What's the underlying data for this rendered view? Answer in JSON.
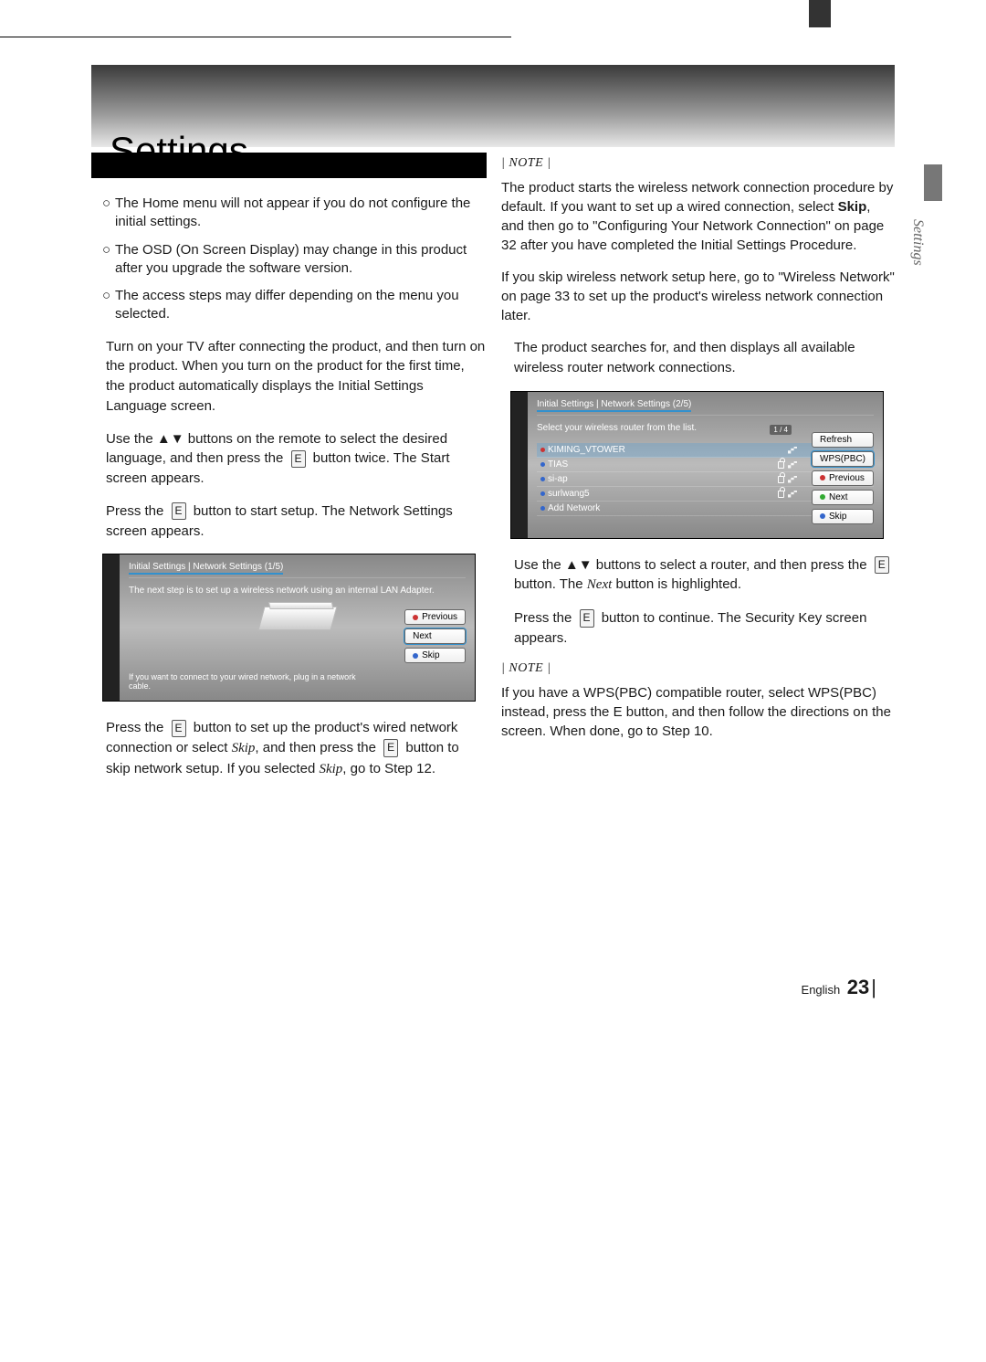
{
  "title": "Settings",
  "side_tab_label": "Settings",
  "bullets": [
    "The Home menu will not appear if you do not configure the initial settings.",
    "The OSD (On Screen Display) may change in this product after you upgrade the software version.",
    "The access steps may differ depending on the menu you selected."
  ],
  "steps_left": {
    "s1": "Turn on your TV after connecting the product, and then turn on the product. When you turn on the product for the first time, the product automatically displays the Initial Settings Language screen.",
    "s2_pre": "Use the ▲▼ buttons on the remote to select the desired language, and then press the ",
    "s2_post": " button twice. The Start screen appears.",
    "s3_pre": "Press the ",
    "s3_post": " button to start setup. The Network Settings screen appears.",
    "s4_pre": "Press the ",
    "s4_mid": " button to set up the product's wired network connection or select ",
    "s4_skip": "Skip",
    "s4_mid2": ", and then press the ",
    "s4_post": " button to skip network setup. If you selected ",
    "s4_skip2": "Skip",
    "s4_end": ", go to Step 12."
  },
  "enter_label": "E",
  "note_label": "NOTE",
  "note_right_1_pre": "The product starts the wireless network connection procedure by default. If you want to set up a wired connection, select ",
  "note_right_1_skip": "Skip",
  "note_right_1_post": ", and then go to \"Configuring Your Network Connection\" on page 32 after you have completed the Initial Settings Procedure.",
  "note_right_2": "If you skip wireless network setup here, go to \"Wireless Network\" on page 33 to set up the product's wireless network connection later.",
  "step5": "The product searches for, and then displays all available wireless router network connections.",
  "steps_right": {
    "s6_pre": "Use the ▲▼ buttons to select a router, and then press the ",
    "s6_mid": " button. The ",
    "s6_next": "Next",
    "s6_post": " button is highlighted.",
    "s7_pre": "Press the ",
    "s7_post": " button to continue. The Security Key screen appears."
  },
  "note_right_3_pre": "If you have a WPS(PBC) compatible router, select WPS(PBC) instead, press the ",
  "note_right_3_post": " button, and then follow the directions on the screen. When done, go to Step 10.",
  "tv1": {
    "crumb": "Initial Settings  |  Network Settings (1/5)",
    "desc": "The next step is to set up a wireless network using an internal LAN Adapter.",
    "foot": "If you want to connect to your wired network, plug in a network cable.",
    "btns": {
      "prev": "Previous",
      "next": "Next",
      "skip": "Skip"
    }
  },
  "tv2": {
    "crumb": "Initial Settings  |  Network Settings (2/5)",
    "desc": "Select your wireless router from the list.",
    "count": "1 / 4",
    "rows": [
      {
        "name": "KIMING_VTOWER",
        "lock": false
      },
      {
        "name": "TIAS",
        "lock": true
      },
      {
        "name": "si-ap",
        "lock": true
      },
      {
        "name": "surlwang5",
        "lock": true
      },
      {
        "name": "Add Network",
        "lock": false
      }
    ],
    "btns": {
      "refresh": "Refresh",
      "wps": "WPS(PBC)",
      "prev": "Previous",
      "next": "Next",
      "skip": "Skip"
    }
  },
  "footer": {
    "lang": "English",
    "page": "23"
  }
}
